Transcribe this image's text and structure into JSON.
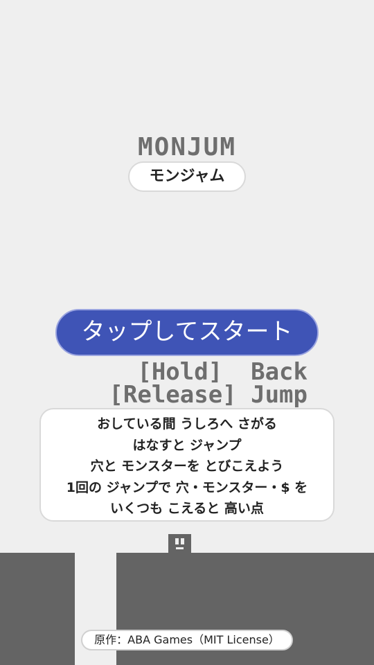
{
  "title": "MONJUM",
  "subtitle": "モンジャム",
  "start_button": "タップしてスタート",
  "controls": {
    "hold": "[Hold]  Back",
    "release": "[Release] Jump"
  },
  "instructions": [
    "おしている間 うしろへ さがる",
    "はなすと ジャンプ",
    "穴と モンスターを とびこえよう",
    "1回の ジャンプで 穴・モンスター・$ を",
    "いくつも こえると 高い点"
  ],
  "credit": "原作：ABA Games（MIT License）",
  "colors": {
    "background": "#efefef",
    "accent": "#3f54b6",
    "ground": "#646464"
  }
}
